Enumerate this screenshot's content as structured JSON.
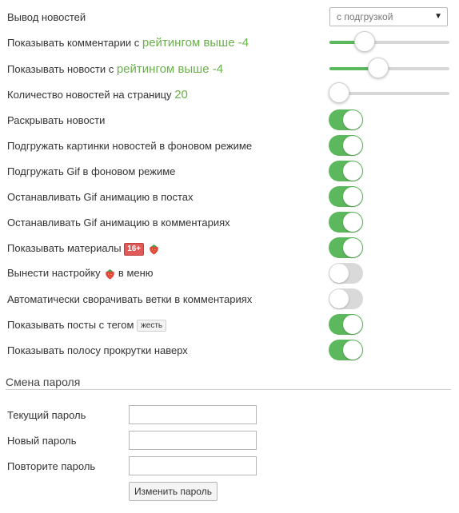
{
  "settings": {
    "news_output": {
      "label": "Вывод новостей",
      "selected": "с подгрузкой"
    },
    "comments_rating": {
      "label_prefix": "Показывать комментарии с",
      "label_value": "рейтингом выше -4",
      "slider_fraction": 0.29
    },
    "news_rating": {
      "label_prefix": "Показывать новости с",
      "label_value": "рейтингом выше -4",
      "slider_fraction": 0.41
    },
    "news_per_page": {
      "label_prefix": "Количество новостей на страницу",
      "label_value": "20",
      "slider_fraction": 0.08
    },
    "toggles": [
      {
        "label": "Раскрывать новости",
        "on": true
      },
      {
        "label": "Подгружать картинки новостей в фоновом режиме",
        "on": true
      },
      {
        "label": "Подгружать Gif в фоновом режиме",
        "on": true
      },
      {
        "label": "Останавливать Gif анимацию в постах",
        "on": true
      },
      {
        "label": "Останавливать Gif анимацию в комментариях",
        "on": true
      },
      {
        "label": "Показывать материалы",
        "badge": "16+",
        "icon": "strawberry-icon",
        "on": true
      },
      {
        "label": "Вынести настройку",
        "icon": "strawberry-icon",
        "label_suffix": "в меню",
        "on": false
      },
      {
        "label": "Автоматически сворачивать ветки в комментариях",
        "on": false
      },
      {
        "label": "Показывать посты с тегом",
        "tag": "жесть",
        "on": true
      },
      {
        "label": "Показывать полосу прокрутки наверх",
        "on": true
      }
    ]
  },
  "password": {
    "title": "Смена пароля",
    "current_label": "Текущий пароль",
    "new_label": "Новый пароль",
    "repeat_label": "Повторите пароль",
    "submit_label": "Изменить пароль"
  },
  "colors": {
    "accent": "#5cb85c",
    "accent_text": "#6ab04c",
    "toggle_off": "#d9d9d9",
    "badge": "#e05a5a"
  }
}
